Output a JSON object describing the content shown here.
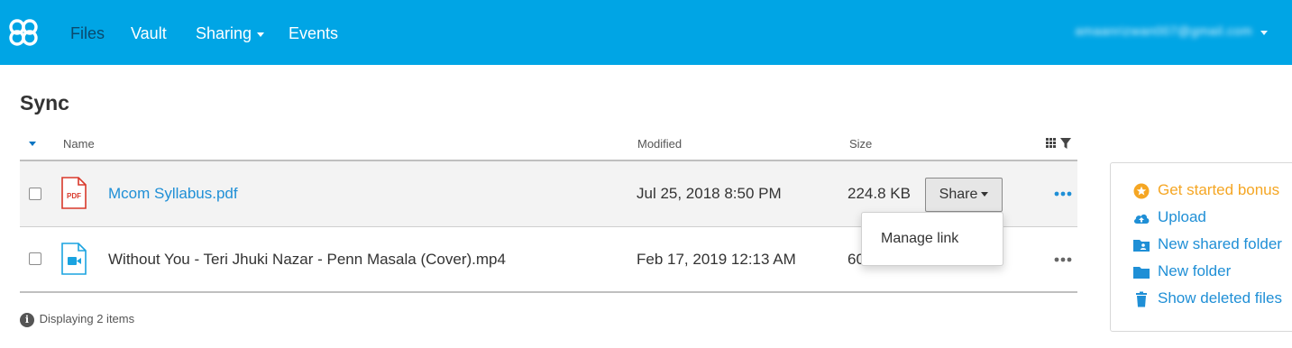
{
  "nav": {
    "items": [
      "Files",
      "Vault",
      "Sharing",
      "Events"
    ],
    "active": "Files",
    "account_email": "amaanrizwan007@gmail.com"
  },
  "page": {
    "title": "Sync"
  },
  "table": {
    "headers": {
      "name": "Name",
      "modified": "Modified",
      "size": "Size"
    },
    "rows": [
      {
        "icon": "pdf-file-icon",
        "name": "Mcom Syllabus.pdf",
        "modified": "Jul 25, 2018 8:50 PM",
        "size": "224.8 KB",
        "selected": true
      },
      {
        "icon": "video-file-icon",
        "name": "Without You - Teri Jhuki Nazar - Penn Masala (Cover).mp4",
        "modified": "Feb 17, 2019 12:13 AM",
        "size": "60",
        "selected": false
      }
    ],
    "share_label": "Share",
    "dropdown_item": "Manage link",
    "status": "Displaying 2 items"
  },
  "sidebar": {
    "items": [
      {
        "label": "Get started bonus",
        "icon": "star-icon"
      },
      {
        "label": "Upload",
        "icon": "cloud-upload-icon"
      },
      {
        "label": "New shared folder",
        "icon": "shared-folder-icon"
      },
      {
        "label": "New folder",
        "icon": "folder-icon"
      },
      {
        "label": "Show deleted files",
        "icon": "trash-icon"
      }
    ]
  },
  "colors": {
    "brand": "#00a5e5",
    "link": "#1f8fd6",
    "bonus": "#f5a623"
  }
}
